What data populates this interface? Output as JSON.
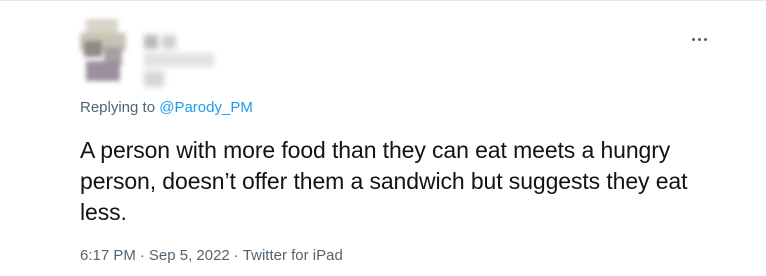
{
  "tweet": {
    "replying_prefix": "Replying to ",
    "replying_handle": "@Parody_PM",
    "text": "A person with more food than they can eat meets a hungry person, doesn’t offer them a sandwich but suggests they eat less.",
    "time": "6:17 PM",
    "separator": "·",
    "date": "Sep 5, 2022",
    "source": "Twitter for iPad"
  },
  "icons": {
    "more": "more-horizontal-icon"
  },
  "colors": {
    "text": "#0f1419",
    "secondary": "#536471",
    "link": "#1d9bf0"
  }
}
